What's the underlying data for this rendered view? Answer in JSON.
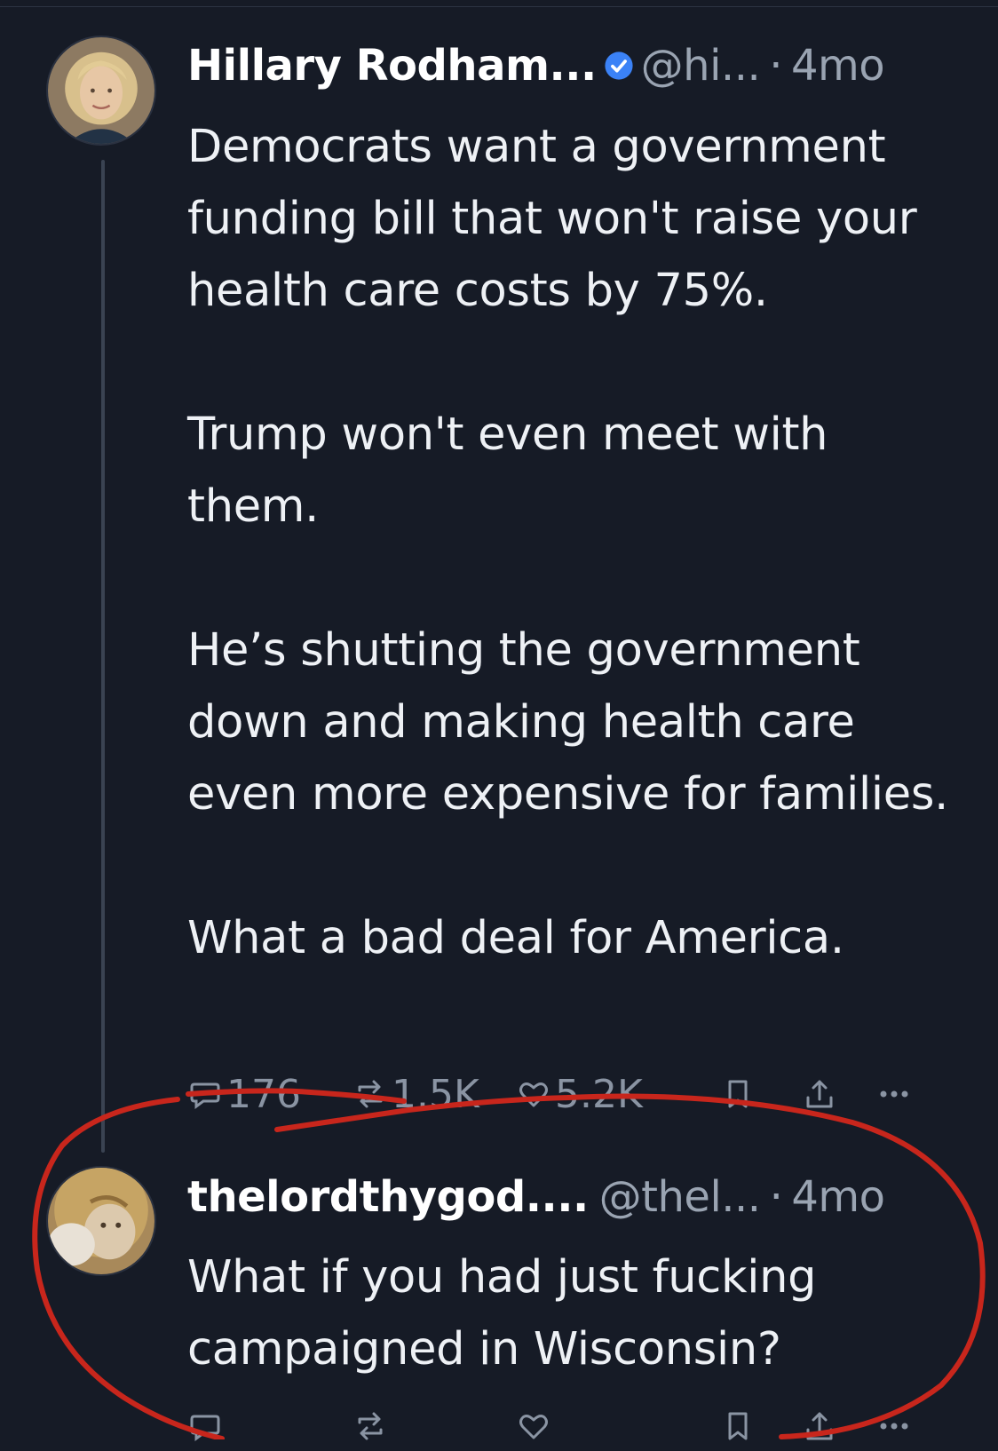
{
  "post": {
    "author_name": "Hillary Rodham...",
    "handle": "@hi...",
    "separator": "·",
    "time": "4mo",
    "avatar_icon": "person-avatar-icon",
    "verified_icon": "verified-badge-icon",
    "verified_color": "#3b82f6",
    "paragraphs": [
      "Democrats want a government funding bill that won't raise your health care costs by 75%.",
      "Trump won't even meet with them.",
      "He’s shutting the government down and making health care even more expensive for families.",
      "What a bad deal for America."
    ],
    "stats": {
      "replies": "176",
      "reposts": "1.5K",
      "likes": "5.2K"
    }
  },
  "reply": {
    "author_name": "thelordthygod....",
    "handle": "@thel...",
    "separator": "·",
    "time": "4mo",
    "avatar_icon": "painting-avatar-icon",
    "paragraphs": [
      "What if you had just fucking campaigned in Wisconsin?"
    ]
  },
  "icons": {
    "reply": "reply-icon",
    "repost": "repost-icon",
    "like": "heart-icon",
    "bookmark": "bookmark-icon",
    "share": "share-icon",
    "more": "more-icon"
  },
  "annotation": {
    "color": "#c8261c",
    "shape": "hand-drawn circle and strike-through line"
  },
  "colors": {
    "background": "#161b26",
    "text": "#eef1f5",
    "muted": "#9aa4b2"
  }
}
